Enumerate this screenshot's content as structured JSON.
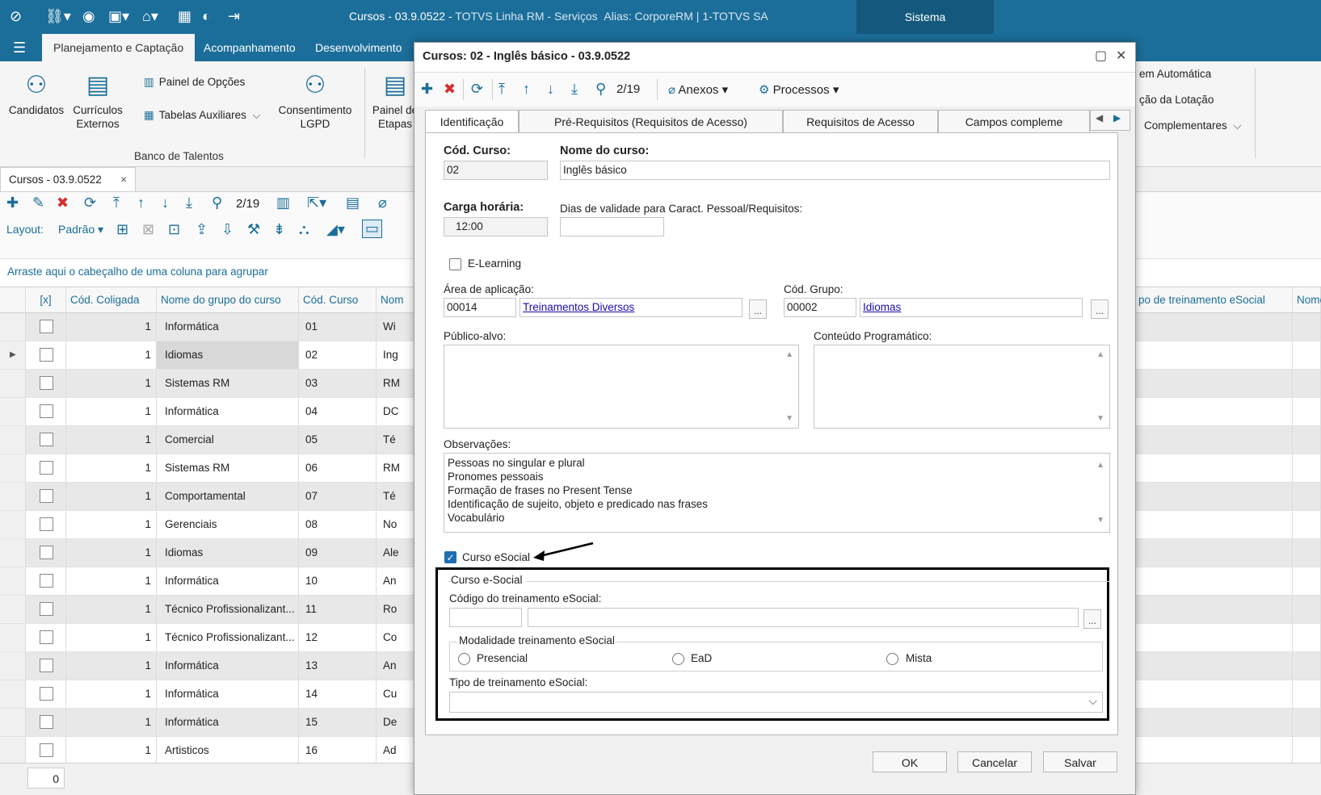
{
  "window": {
    "title": "Cursos - 03.9.0522",
    "app": "TOTVS Linha RM - Serviços",
    "alias": "Alias: CorporeRM | 1-TOTVS SA",
    "system_tab": "Sistema"
  },
  "ribbon": {
    "tabs": [
      "Planejamento e Captação",
      "Acompanhamento",
      "Desenvolvimento"
    ],
    "buttons": {
      "candidatos": "Candidatos",
      "curriculos_1": "Currículos",
      "curriculos_2": "Externos",
      "painel_opcoes": "Painel de Opções",
      "tabelas_aux": "Tabelas Auxiliares",
      "consent_1": "Consentimento",
      "consent_2": "LGPD",
      "painel_1": "Painel de",
      "painel_2": "Etapas",
      "right_1": "em Automática",
      "right_2": "ção da Lotação",
      "right_3": "Complementares"
    },
    "group_label": "Banco de Talentos"
  },
  "doc_tab": {
    "label": "Cursos - 03.9.0522",
    "close": "×"
  },
  "grid_toolbar": {
    "nav": "2/19",
    "layout_label": "Layout:",
    "layout_value": "Padrão"
  },
  "group_hint": "Arraste aqui o cabeçalho de uma coluna para agrupar",
  "grid": {
    "headers": {
      "sel": "[x]",
      "coligada": "Cód. Coligada",
      "grupo": "Nome do grupo do curso",
      "codcurso": "Cód. Curso",
      "nome": "Nom",
      "tipo": "po de treinamento eSocial",
      "nome2": "Nome"
    },
    "rows": [
      {
        "col": "1",
        "grupo": "Informática",
        "cod": "01",
        "nome": "Wi"
      },
      {
        "col": "1",
        "grupo": "Idiomas",
        "cod": "02",
        "nome": "Ing"
      },
      {
        "col": "1",
        "grupo": "Sistemas RM",
        "cod": "03",
        "nome": "RM"
      },
      {
        "col": "1",
        "grupo": "Informática",
        "cod": "04",
        "nome": "DC"
      },
      {
        "col": "1",
        "grupo": "Comercial",
        "cod": "05",
        "nome": "Té"
      },
      {
        "col": "1",
        "grupo": "Sistemas RM",
        "cod": "06",
        "nome": "RM"
      },
      {
        "col": "1",
        "grupo": "Comportamental",
        "cod": "07",
        "nome": "Té"
      },
      {
        "col": "1",
        "grupo": "Gerenciais",
        "cod": "08",
        "nome": "No"
      },
      {
        "col": "1",
        "grupo": "Idiomas",
        "cod": "09",
        "nome": "Ale"
      },
      {
        "col": "1",
        "grupo": "Informática",
        "cod": "10",
        "nome": "An"
      },
      {
        "col": "1",
        "grupo": "Técnico Profissionalizant...",
        "cod": "11",
        "nome": "Ro"
      },
      {
        "col": "1",
        "grupo": "Técnico Profissionalizant...",
        "cod": "12",
        "nome": "Co"
      },
      {
        "col": "1",
        "grupo": "Informática",
        "cod": "13",
        "nome": "An"
      },
      {
        "col": "1",
        "grupo": "Informática",
        "cod": "14",
        "nome": "Cu"
      },
      {
        "col": "1",
        "grupo": "Informática",
        "cod": "15",
        "nome": "De"
      },
      {
        "col": "1",
        "grupo": "Artisticos",
        "cod": "16",
        "nome": "Ad"
      }
    ],
    "footer_count": "0"
  },
  "dialog": {
    "title": "Cursos: 02 - Inglês básico - 03.9.0522",
    "nav": "2/19",
    "anexos": "Anexos",
    "processos": "Processos",
    "tabs": [
      "Identificação",
      "Pré-Requisitos (Requisitos de Acesso)",
      "Requisitos de Acesso",
      "Campos compleme"
    ],
    "form": {
      "cod_curso_label": "Cód. Curso:",
      "cod_curso": "02",
      "nome_label": "Nome do curso:",
      "nome": "Inglês básico",
      "carga_label": "Carga horária:",
      "carga": "12:00",
      "dias_label": "Dias de validade para Caract. Pessoal/Requisitos:",
      "dias": "",
      "elearning": "E-Learning",
      "area_label": "Área de aplicação:",
      "area_cod": "00014",
      "area_nome": "Treinamentos Diversos",
      "grupo_label": "Cód. Grupo:",
      "grupo_cod": "00002",
      "grupo_nome": "Idiomas",
      "publico_label": "Público-alvo:",
      "conteudo_label": "Conteúdo Programático:",
      "obs_label": "Observações:",
      "obs_lines": [
        "Pessoas no singular e plural",
        "Pronomes pessoais",
        "Formação de frases no Present Tense",
        "Identificação de sujeito, objeto e predicado nas frases",
        "Vocabulário"
      ],
      "curso_esocial": "Curso eSocial",
      "esocial_group": "Curso e-Social",
      "codigo_trein_label": "Código do treinamento eSocial:",
      "modalidade_label": "Modalidade treinamento eSocial",
      "modalidades": [
        "Presencial",
        "EaD",
        "Mista"
      ],
      "tipo_label": "Tipo de treinamento eSocial:"
    },
    "buttons": {
      "ok": "OK",
      "cancel": "Cancelar",
      "save": "Salvar"
    }
  },
  "colors": {
    "brand": "#1b6e9a",
    "accent": "#1f6fb2",
    "delete": "#d32f2f"
  }
}
